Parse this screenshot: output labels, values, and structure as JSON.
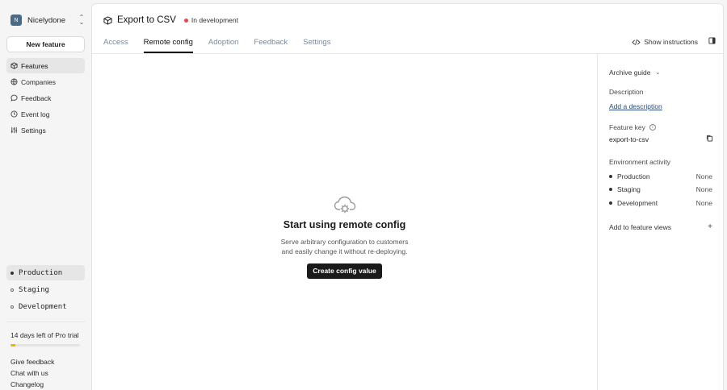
{
  "org": {
    "initial": "N",
    "name": "Nicelydone"
  },
  "sidebar": {
    "new_feature_label": "New feature",
    "nav": [
      {
        "label": "Features",
        "icon": "cube-icon",
        "active": true
      },
      {
        "label": "Companies",
        "icon": "globe-icon",
        "active": false
      },
      {
        "label": "Feedback",
        "icon": "chat-bubble-icon",
        "active": false
      },
      {
        "label": "Event log",
        "icon": "clock-icon",
        "active": false
      },
      {
        "label": "Settings",
        "icon": "sliders-icon",
        "active": false
      }
    ],
    "environments": [
      {
        "label": "Production",
        "active": true
      },
      {
        "label": "Staging",
        "active": false
      },
      {
        "label": "Development",
        "active": false
      }
    ],
    "trial_text": "14 days left of Pro trial",
    "trial_progress": 0.07,
    "trial_color": "#f2b600",
    "footer_links": [
      "Give feedback",
      "Chat with us",
      "Changelog"
    ]
  },
  "header": {
    "title": "Export to CSV",
    "status": "In development",
    "status_color": "#e5484d",
    "tabs": [
      {
        "label": "Access",
        "active": false
      },
      {
        "label": "Remote config",
        "active": true
      },
      {
        "label": "Adoption",
        "active": false
      },
      {
        "label": "Feedback",
        "active": false
      },
      {
        "label": "Settings",
        "active": false
      }
    ],
    "show_instructions_label": "Show instructions"
  },
  "empty_state": {
    "title": "Start using remote config",
    "description_line1": "Serve arbitrary configuration to customers",
    "description_line2": "and easily change it without re-deploying.",
    "button_label": "Create config value"
  },
  "details": {
    "archive_guide": "Archive guide",
    "description_label": "Description",
    "add_description_link": "Add a description",
    "feature_key_label": "Feature key",
    "feature_key_value": "export-to-csv",
    "environment_activity_label": "Environment activity",
    "environment_activity": [
      {
        "name": "Production",
        "value": "None"
      },
      {
        "name": "Staging",
        "value": "None"
      },
      {
        "name": "Development",
        "value": "None"
      }
    ],
    "add_to_views_label": "Add to feature views"
  }
}
